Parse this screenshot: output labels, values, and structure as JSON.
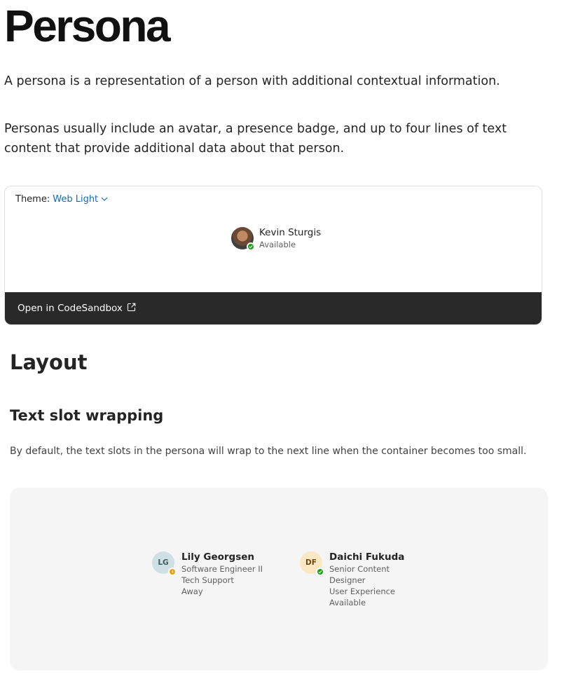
{
  "page": {
    "title": "Persona",
    "intro": "A persona is a representation of a person with additional contextual information.",
    "description": "Personas usually include an avatar, a presence badge, and up to four lines of text content that provide additional data about that person."
  },
  "example": {
    "theme_label": "Theme:",
    "theme_value": "Web Light",
    "persona": {
      "name": "Kevin Sturgis",
      "status": "Available"
    },
    "codesandbox_label": "Open in CodeSandbox"
  },
  "layout": {
    "heading": "Layout",
    "subheading": "Text slot wrapping",
    "text": "By default, the text slots in the persona will wrap to the next line when the container becomes too small.",
    "personas": [
      {
        "initials": "LG",
        "name": "Lily Georgsen",
        "lines": [
          "Software Engineer II",
          "Tech Support",
          "Away"
        ],
        "presence": "away"
      },
      {
        "initials": "DF",
        "name": "Daichi Fukuda",
        "lines": [
          "Senior Content",
          "Designer",
          "User Experience",
          "Available"
        ],
        "presence": "available"
      }
    ]
  },
  "colors": {
    "available": "#13a10e",
    "away": "#eaa300",
    "link": "#0f6cbd",
    "codesandbox_bar": "#292929"
  }
}
